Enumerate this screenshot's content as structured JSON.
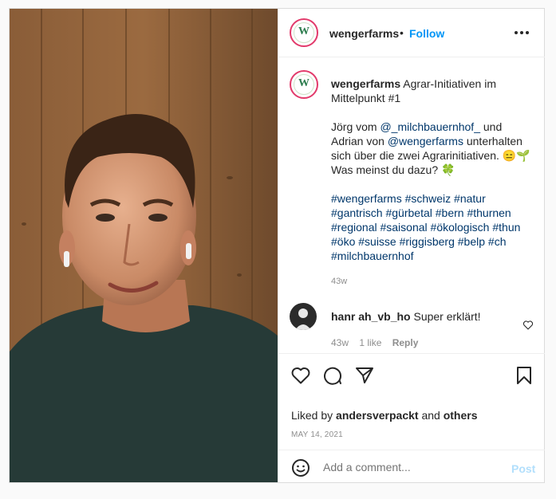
{
  "header": {
    "username": "wengerfarms",
    "dot": "•",
    "follow_label": "Follow",
    "more_icon": "more-horizontal-icon"
  },
  "caption": {
    "username": "wengerfarms",
    "title": "Agrar-Initiativen im Mittelpunkt #1",
    "line1_pre": "Jörg vom ",
    "mention1": "@_milchbauernhof_",
    "line1_mid": " und Adrian von ",
    "mention2": "@wengerfarms",
    "line1_post": " unterhalten sich über die zwei Agrarinitiativen. 😑🌱",
    "line2": "Was meinst du dazu? 🍀",
    "hashtags": "#wengerfarms #schweiz #natur #gantrisch #gürbetal #bern #thurnen #regional #saisonal #ökologisch #thun #öko #suisse #riggisberg #belp #ch #milchbauernhof",
    "time": "43w"
  },
  "comment": {
    "username": "hanr ah_vb_ho",
    "text": "Super erklärt!",
    "time": "43w",
    "likes": "1 like",
    "reply": "Reply"
  },
  "likes": {
    "prefix": "Liked by ",
    "user": "andersverpackt",
    "mid": " and ",
    "others": "others"
  },
  "date": "MAY 14, 2021",
  "add_comment": {
    "placeholder": "Add a comment...",
    "post_label": "Post"
  },
  "colors": {
    "accent": "#0095f6",
    "link": "#00376b",
    "post_disabled": "#b2dffc"
  }
}
